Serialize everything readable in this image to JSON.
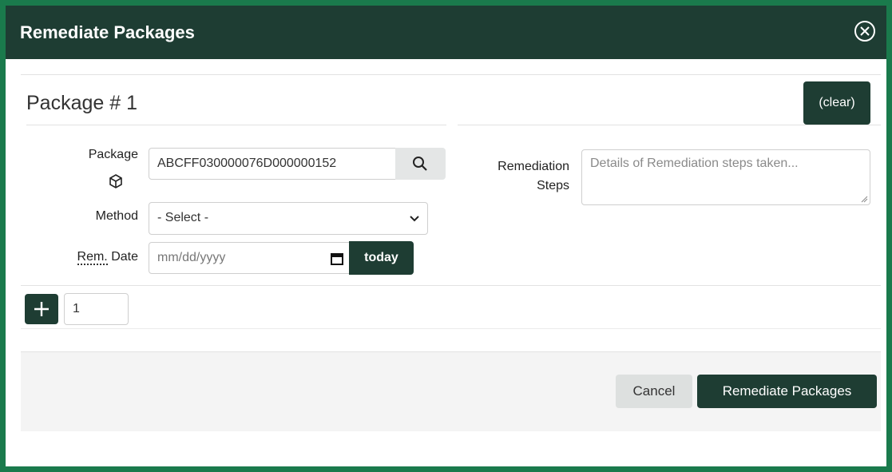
{
  "dialog": {
    "title": "Remediate Packages"
  },
  "package": {
    "heading": "Package # 1",
    "clear_label": "(clear)",
    "package_label": "Package",
    "package_value": "ABCFF030000076D000000152",
    "method_label": "Method",
    "method_selected": "- Select -",
    "date_label_abbr": "Rem.",
    "date_label_rest": " Date",
    "date_placeholder": "mm/dd/yyyy",
    "today_label": "today",
    "steps_label_line1": "Remediation",
    "steps_label_line2": "Steps",
    "steps_placeholder": "Details of Remediation steps taken..."
  },
  "add_row": {
    "count_value": "1"
  },
  "footer": {
    "cancel_label": "Cancel",
    "submit_label": "Remediate Packages"
  },
  "colors": {
    "header_bg": "#1e3d33",
    "frame_border": "#1a7a4c",
    "button_dark": "#1e3d33"
  },
  "icons": [
    "close-circle-icon",
    "package-cube-icon",
    "search-icon",
    "calendar-icon",
    "chevron-down-icon",
    "plus-icon",
    "resize-grip-icon"
  ]
}
